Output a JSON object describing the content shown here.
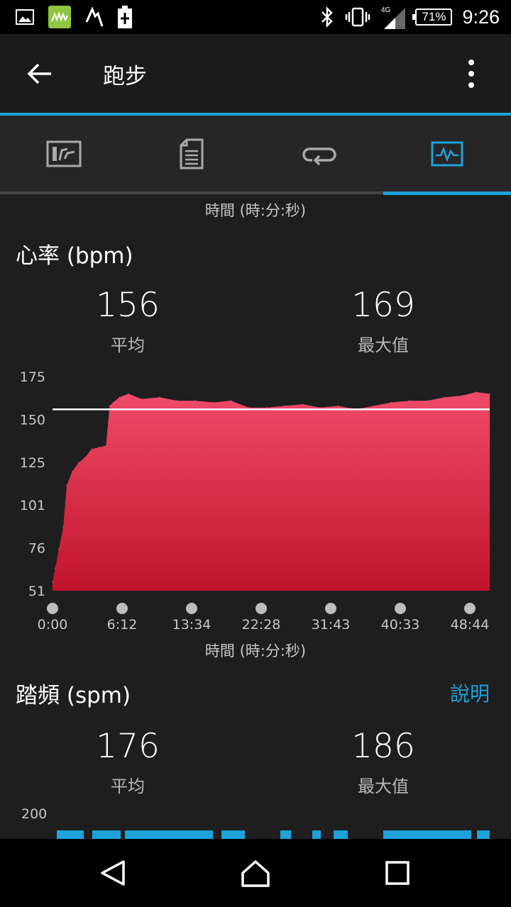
{
  "status_bar": {
    "time": "9:26",
    "battery": "71%",
    "network": "4G",
    "left_icons": [
      "gallery-icon",
      "app-icon",
      "activity-icon",
      "battery-saver-icon"
    ],
    "right_icons": [
      "bluetooth-icon",
      "vibrate-icon",
      "signal-icon"
    ]
  },
  "app_bar": {
    "title": "跑步"
  },
  "tabs": [
    {
      "icon": "chart-card-icon",
      "active": false
    },
    {
      "icon": "details-icon",
      "active": false
    },
    {
      "icon": "laps-icon",
      "active": false
    },
    {
      "icon": "graph-icon",
      "active": true
    }
  ],
  "top_axis_caption": "時間 (時:分:秒)",
  "heart_rate": {
    "title": "心率 (bpm)",
    "avg_value": "156",
    "avg_label": "平均",
    "max_value": "169",
    "max_label": "最大值",
    "x_axis_title": "時間 (時:分:秒)"
  },
  "cadence": {
    "title": "踏頻 (spm)",
    "help_label": "說明",
    "avg_value": "176",
    "avg_label": "平均",
    "max_value": "186",
    "max_label": "最大值",
    "y_top_tick": "200"
  },
  "colors": {
    "accent": "#1ea2d9",
    "hr_fill_top": "#f04b6a",
    "hr_fill_bottom": "#c0142c",
    "avg_line": "#ffffff",
    "cadence": "#1ea2d9"
  },
  "chart_data": {
    "type": "area",
    "title": "心率 (bpm)",
    "xlabel": "時間 (時:分:秒)",
    "ylabel": "",
    "y_ticks": [
      "175",
      "150",
      "125",
      "101",
      "76",
      "51"
    ],
    "ylim": [
      51,
      175
    ],
    "x_ticks": [
      "0:00",
      "6:12",
      "13:34",
      "22:28",
      "31:43",
      "40:33",
      "48:44"
    ],
    "x_minutes": [
      0,
      0.3,
      0.7,
      1.2,
      1.6,
      2.2,
      2.9,
      3.6,
      4.4,
      5.2,
      6.0,
      6.4,
      6.8,
      7.5,
      8.5,
      10.0,
      12.0,
      14.0,
      16.0,
      18.0,
      20.0,
      22.0,
      24.0,
      26.0,
      28.0,
      30.0,
      32.0,
      34.0,
      36.0,
      38.0,
      40.0,
      42.0,
      44.0,
      46.0,
      47.5,
      49.0
    ],
    "values": [
      56,
      64,
      75,
      88,
      112,
      120,
      125,
      128,
      133,
      134,
      135,
      158,
      160,
      163,
      165,
      162,
      163,
      161,
      161,
      160,
      161,
      157,
      157,
      158,
      159,
      157,
      158,
      156,
      158,
      160,
      161,
      161,
      163,
      164,
      166,
      165
    ],
    "average_line": 156,
    "grid": false,
    "legend": "none"
  }
}
